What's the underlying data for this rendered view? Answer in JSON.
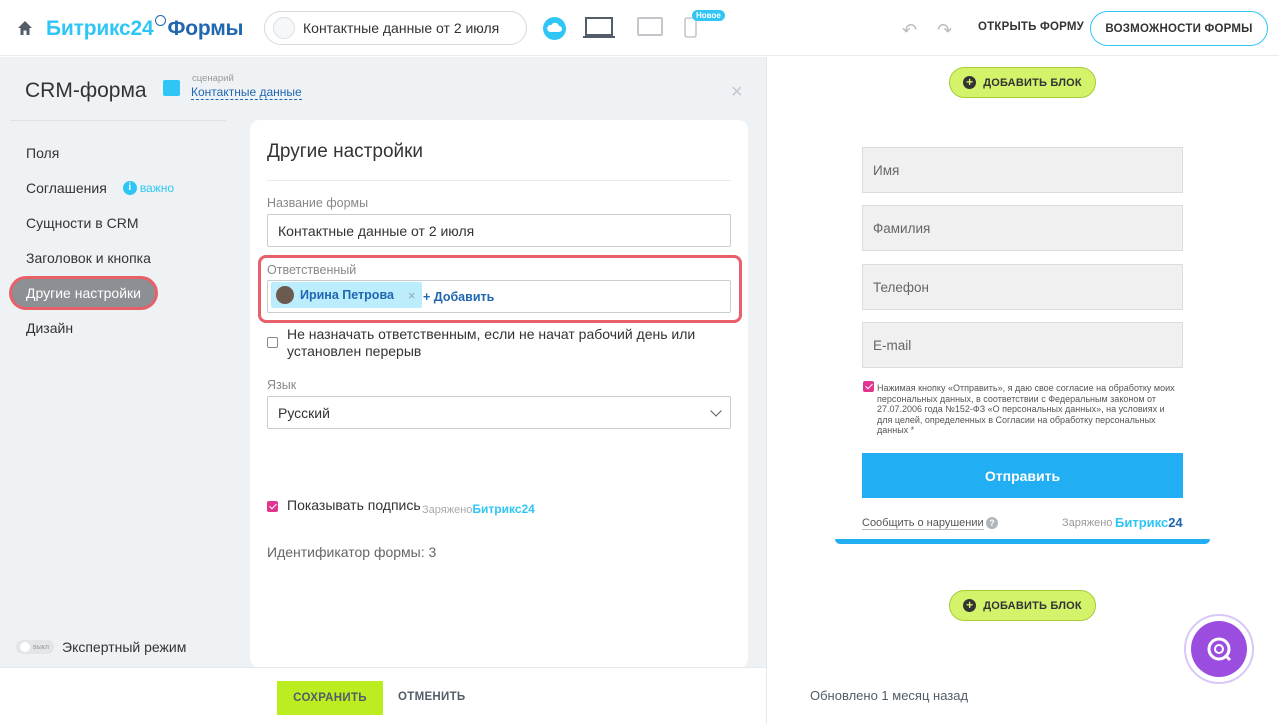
{
  "topbar": {
    "logo_part1": "Битрикс24",
    "logo_part2": "Формы",
    "form_name": "Контактные данные от 2 июля",
    "new_badge": "Новое",
    "open_form": "ОТКРЫТЬ ФОРМУ",
    "capabilities": "ВОЗМОЖНОСТИ ФОРМЫ",
    "icons": [
      "home-icon",
      "cloud-icon",
      "laptop-icon",
      "tablet-icon",
      "phone-icon",
      "undo-icon",
      "redo-icon"
    ]
  },
  "sidebar": {
    "title": "CRM-форма",
    "scenario_small": "сценарий",
    "scenario_link": "Контактные данные",
    "items": [
      {
        "label": "Поля"
      },
      {
        "label": "Соглашения",
        "badge": "важно"
      },
      {
        "label": "Сущности в CRM"
      },
      {
        "label": "Заголовок и кнопка"
      },
      {
        "label": "Другие настройки",
        "active": true
      },
      {
        "label": "Дизайн"
      }
    ],
    "expert_toggle": "выкл",
    "expert_label": "Экспертный режим"
  },
  "card": {
    "title": "Другие настройки",
    "form_name_label": "Название формы",
    "form_name_value": "Контактные данные от 2 июля",
    "responsible_label": "Ответственный",
    "responsible_person": "Ирина Петрова",
    "responsible_add": "+ Добавить",
    "no_assign_text_1": "Не назначать ответственным, если не начат рабочий день или",
    "no_assign_text_2": "установлен перерыв",
    "language_label": "Язык",
    "language_value": "Русский",
    "show_sign_label": "Показывать подпись",
    "charged": "Заряжено",
    "b24": "Битрикс24",
    "form_id": "Идентификатор формы: 3"
  },
  "bottom": {
    "save": "СОХРАНИТЬ",
    "cancel": "ОТМЕНИТЬ"
  },
  "preview": {
    "add_block": "ДОБАВИТЬ БЛОК",
    "fields": [
      "Имя",
      "Фамилия",
      "Телефон",
      "E-mail"
    ],
    "consent": "Нажимая кнопку «Отправить», я даю свое согласие на обработку моих персональных данных, в соответствии с Федеральным законом от 27.07.2006 года №152-ФЗ «О персональных данных», на условиях и для целей, определенных в Согласии на обработку персональных данных *",
    "send": "Отправить",
    "report": "Сообщить о нарушении",
    "charged": "Заряжено",
    "b24_a": "Битрикс",
    "b24_b": "24",
    "updated": "Обновлено 1 месяц назад"
  },
  "colors": {
    "accent": "#2fc6f6",
    "brand_dark": "#2067b0",
    "save": "#bbed21",
    "highlight": "#e8606a",
    "send": "#22aef3"
  }
}
